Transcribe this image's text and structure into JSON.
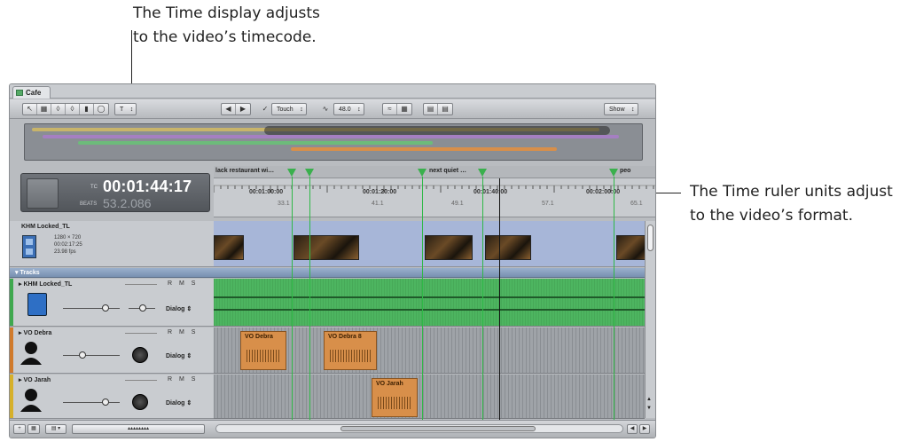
{
  "callouts": {
    "time_display_line1": "The Time display adjusts",
    "time_display_line2": "to the video’s timecode.",
    "ruler_line1": "The Time ruler units adjust",
    "ruler_line2": "to the video’s format."
  },
  "window": {
    "tab_label": "Cafe",
    "toolbar": {
      "snap_popup": "Touch",
      "zoom_popup": "48.0",
      "show_popup": "Show"
    }
  },
  "time_display": {
    "main_label": "TC",
    "main_value": "00:01:44:17",
    "sub_label": "BEATS",
    "sub_value": "53.2.086"
  },
  "ruler": {
    "markers": [
      "lack restaurant wi…",
      "next quiet …",
      "peo"
    ],
    "timecodes": [
      "00:01:00:00",
      "00:01:20:00",
      "00:01:40:00",
      "00:02:00:00"
    ],
    "frames": [
      "33.1",
      "41.1",
      "49.1",
      "57.1",
      "65.1"
    ]
  },
  "video_track": {
    "name": "KHM Locked_TL",
    "resolution": "1280 × 720",
    "duration": "00:02:17:25",
    "fps": "23.98 fps"
  },
  "tracks_header": "▾ Tracks",
  "tracks": [
    {
      "name": "KHM Locked_TL",
      "flags": "R M S",
      "role": "Dialog",
      "color": "#3fa84f"
    },
    {
      "name": "VO Debra",
      "flags": "R M S",
      "role": "Dialog",
      "color": "#d07a2b"
    },
    {
      "name": "VO Jarah",
      "flags": "R M S",
      "role": "Dialog",
      "color": "#d6b02a"
    }
  ],
  "clips": {
    "vo_debra_1": "VO Debra",
    "vo_debra_2": "VO Debra 8",
    "vo_jarah_1": "VO Jarah"
  },
  "colors": {
    "marker_green": "#3ab04d",
    "audio_green": "#4db560",
    "clip_orange": "#d88f4a",
    "video_lane": "#a7b6d8"
  }
}
